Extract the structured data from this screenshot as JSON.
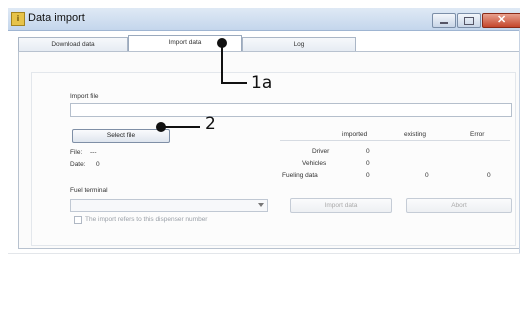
{
  "window": {
    "title": "Data import",
    "app_icon": "app-icon-i"
  },
  "tabs": [
    {
      "label": "Download data",
      "active": false
    },
    {
      "label": "Import data",
      "active": true
    },
    {
      "label": "Log",
      "active": false
    }
  ],
  "import_file": {
    "label": "Import file",
    "value": ""
  },
  "select_file_label": "Select file",
  "file_label": "File:",
  "file_value": "---",
  "date_label": "Date:",
  "date_value": "0",
  "stats": {
    "headers": [
      "imported",
      "existing",
      "Error"
    ],
    "rows": [
      {
        "label": "Driver",
        "imported": "0",
        "existing": "",
        "error": ""
      },
      {
        "label": "Vehicles",
        "imported": "0",
        "existing": "",
        "error": ""
      },
      {
        "label": "Fueling data",
        "imported": "0",
        "existing": "0",
        "error": "0"
      }
    ]
  },
  "fuel_terminal": {
    "label": "Fuel terminal",
    "selected": ""
  },
  "checkbox_label": "The import refers to this dispenser number",
  "import_button": "Import data",
  "abort_button": "Abort",
  "callouts": {
    "c1": "1a",
    "c2": "2"
  }
}
